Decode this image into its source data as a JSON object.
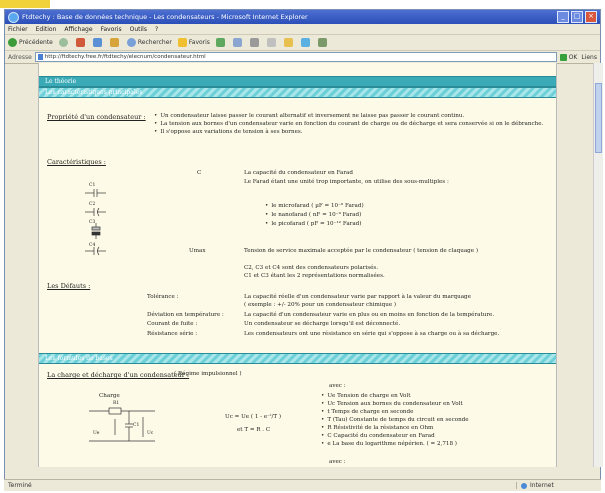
{
  "window": {
    "title": "Ftdtechy : Base de données technique - Les condensateurs - Microsoft Internet Explorer"
  },
  "menu": [
    "Fichier",
    "Edition",
    "Affichage",
    "Favoris",
    "Outils",
    "?"
  ],
  "toolbar": {
    "back": "Précédente",
    "search": "Rechercher",
    "favorites": "Favoris"
  },
  "address": {
    "label": "Adresse",
    "url": "http://ftdtechy.free.fr/ftdtechy/elecnum/condensateur.html",
    "go": "OK",
    "links": "Liens"
  },
  "page": {
    "section1_band": "Le théorie",
    "section1_sub": "Les caractéristiques principales",
    "propriete_title": "Propriété d'un condensateur :",
    "propriete_items": [
      "Un condensateur laisse passer le courant alternatif et inversement ne laisse pas passer le courant continu.",
      "La tension aux bornes d'un condensateur varie en fonction du courant de charge ou de décharge et sera conservée si on le débranche.",
      "Il s'oppose aux variations de tension à ses bornes."
    ],
    "carac_title": "Caractéristiques :",
    "c_symbol": "C",
    "c_desc1": "La capacité du condensateur en Farad",
    "c_desc2": "Le Farad étant une unité trop importante, on utilise des sous-multiples :",
    "units": [
      "le microfarad ( µF = 10⁻⁶ Farad)",
      "le nanofarad ( nF = 10⁻⁹ Farad)",
      "le picofarad ( pF = 10⁻¹² Farad)"
    ],
    "comp_labels": [
      "C1",
      "C2",
      "C3",
      "C4"
    ],
    "umax_label": "Umax",
    "umax_desc": "Tension de service maximale acceptée par le condensateur ( tension de claquage )",
    "polar1": "C2, C3 et C4 sont des condensateurs polarisés.",
    "polar2": "C1 et C3 étant les 2 représentations normalisées.",
    "defauts_title": "Les Défauts :",
    "defauts": [
      {
        "label": "Tolérance :",
        "desc": "La capacité réelle d'un condensateur varie par rapport à la valeur du marquage",
        "desc2": "( exemple : +/- 20% pour un condensateur chimique )"
      },
      {
        "label": "Déviation en température :",
        "desc": "La capacité d'un condensateur varie en plus ou en moins en fonction de la température.",
        "desc2": ""
      },
      {
        "label": "Courant de fuite :",
        "desc": "Un condensateur se décharge lorsqu'il est déconnecté.",
        "desc2": ""
      },
      {
        "label": "Résistance série :",
        "desc": "Les condensateurs ont une résistance en série qui s'oppose à sa charge ou à sa décharge.",
        "desc2": ""
      }
    ],
    "section2_band": "Les formules de bases",
    "charge_title": "La charge et décharge d'un condensateur :",
    "charge_sub": "( Régime impulsionnel )",
    "schema_label": "Charge",
    "schema_r": "R1",
    "schema_c": "C1",
    "schema_ue": "Ue",
    "schema_uc": "Uc",
    "formula": "Uc = Ue ( 1 - e⁻ᵗ/T )",
    "formula2": "et T = R . C",
    "avec": "avec :",
    "legend": [
      "Ue  Tension de charge en Volt",
      "Uc  Tension aux bornes du condensateur en Volt",
      "t   Temps de charge en seconde",
      "T   (Tau) Constante de temps du circuit en seconde",
      "R   Résistivité de la résistance en Ohm",
      "C   Capacité du condensateur en Farad",
      "e   La base du logarithme népérien. ( = 2,718 )"
    ],
    "avec2": "avec :"
  },
  "status": {
    "done": "Terminé",
    "zone": "Internet"
  },
  "colors": {
    "band": "#3aaab6",
    "page_bg": "#fdfbe7",
    "titlebar": "#2b4fb8"
  }
}
